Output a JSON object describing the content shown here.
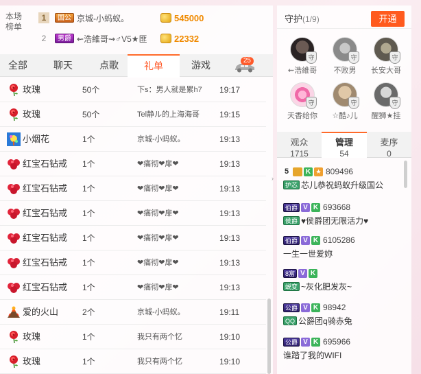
{
  "rank": {
    "label": "本场榜单",
    "rows": [
      {
        "num": "1",
        "badge": "国公",
        "name": "京城-小蚂蚁。",
        "value": "545000"
      },
      {
        "num": "2",
        "badge": "男爵",
        "name": "⇜浩維哥⇝♂V5★匪",
        "value": "22332"
      }
    ]
  },
  "tabs": [
    "全部",
    "聊天",
    "点歌",
    "礼单",
    "游戏"
  ],
  "active_tab": "礼单",
  "car_badge": "25",
  "gifts": [
    {
      "icon": "rose-icon",
      "name": "玫瑰",
      "count": "50个",
      "from": "下s：男人就是累h7",
      "time": "19:17"
    },
    {
      "icon": "rose-icon",
      "name": "玫瑰",
      "count": "50个",
      "from": "Tel静ル的上海海哥",
      "time": "19:15"
    },
    {
      "icon": "firework-icon",
      "name": "小烟花",
      "count": "1个",
      "from": "京城-小蚂蚁。",
      "time": "19:13"
    },
    {
      "icon": "ruby-ring-icon",
      "name": "红宝石钻戒",
      "count": "1个",
      "from": "❤痛彻❤扉❤",
      "time": "19:13"
    },
    {
      "icon": "ruby-ring-icon",
      "name": "红宝石钻戒",
      "count": "1个",
      "from": "❤痛彻❤扉❤",
      "time": "19:13"
    },
    {
      "icon": "ruby-ring-icon",
      "name": "红宝石钻戒",
      "count": "1个",
      "from": "❤痛彻❤扉❤",
      "time": "19:13"
    },
    {
      "icon": "ruby-ring-icon",
      "name": "红宝石钻戒",
      "count": "1个",
      "from": "❤痛彻❤扉❤",
      "time": "19:13"
    },
    {
      "icon": "ruby-ring-icon",
      "name": "红宝石钻戒",
      "count": "1个",
      "from": "❤痛彻❤扉❤",
      "time": "19:13"
    },
    {
      "icon": "ruby-ring-icon",
      "name": "红宝石钻戒",
      "count": "1个",
      "from": "❤痛彻❤扉❤",
      "time": "19:13"
    },
    {
      "icon": "volcano-icon",
      "name": "爱的火山",
      "count": "2个",
      "from": "京城-小蚂蚁。",
      "time": "19:11"
    },
    {
      "icon": "rose-icon",
      "name": "玫瑰",
      "count": "1个",
      "from": "我只有两个忆",
      "time": "19:10"
    },
    {
      "icon": "rose-icon",
      "name": "玫瑰",
      "count": "1个",
      "from": "我只有两个忆",
      "time": "19:10"
    }
  ],
  "guard": {
    "title": "守护",
    "count": "(1/9)",
    "open_label": "开通",
    "shield_char": "守",
    "members": [
      {
        "name": "⇜浩維哥"
      },
      {
        "name": "不败男"
      },
      {
        "name": "长安大哥"
      },
      {
        "name": "天香给你"
      },
      {
        "name": "☆酷♪儿"
      },
      {
        "name": "醒狮★挂"
      }
    ]
  },
  "user_tabs": [
    {
      "label": "观众",
      "count": "1715"
    },
    {
      "label": "管理",
      "count": "54"
    },
    {
      "label": "麦序",
      "count": "0"
    }
  ],
  "users": [
    {
      "level": "5",
      "title": "护芯",
      "fan": "",
      "id": "809496",
      "msg": "芯儿恭祝蚂蚁升级国公"
    },
    {
      "level": "",
      "title": "伯爵",
      "fan": "侯爵",
      "id": "693668",
      "msg": "♥侯爵团无限活力♥"
    },
    {
      "level": "",
      "title": "伯爵",
      "fan": "",
      "id": "6105286",
      "msg": "一生一世爱妳"
    },
    {
      "level": "",
      "title": "8富",
      "fan": "蜕变",
      "id": "",
      "msg": "~灰化肥发灰~"
    },
    {
      "level": "",
      "title": "公爵",
      "fan": "QQ",
      "id": "98942",
      "msg": "公爵团q骑赤兔"
    },
    {
      "level": "",
      "title": "公爵",
      "fan": "",
      "id": "695966",
      "msg": "谁踏了我的WIFI"
    }
  ]
}
